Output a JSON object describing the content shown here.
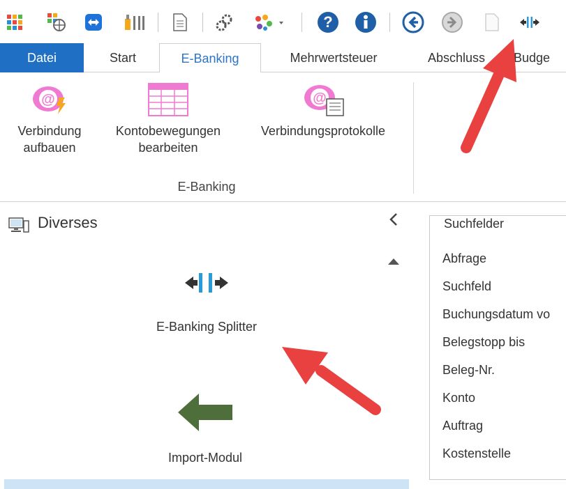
{
  "tabs": {
    "datei": "Datei",
    "start": "Start",
    "ebanking": "E-Banking",
    "mwst": "Mehrwertsteuer",
    "abschluss": "Abschluss",
    "budget": "Budge"
  },
  "ribbon": {
    "btn_verbindung": "Verbindung\naufbauen",
    "btn_kontobewegungen": "Kontobewegungen\nbearbeiten",
    "btn_protokolle": "Verbindungsprotokolle",
    "group_label": "E-Banking"
  },
  "panel": {
    "title": "Diverses",
    "tool_splitter": "E-Banking Splitter",
    "tool_import": "Import-Modul"
  },
  "search": {
    "legend": "Suchfelder",
    "fields": [
      "Abfrage",
      "Suchfeld",
      "Buchungsdatum vo",
      "Belegstopp bis",
      "Beleg-Nr.",
      "Konto",
      "Auftrag",
      "Kostenstelle"
    ]
  },
  "colors": {
    "accent": "#1f6fc5",
    "arrow": "#e8413f",
    "pink": "#f07ad2",
    "import_arrow": "#4e6f3c",
    "splitter": "#2b9bd8"
  }
}
